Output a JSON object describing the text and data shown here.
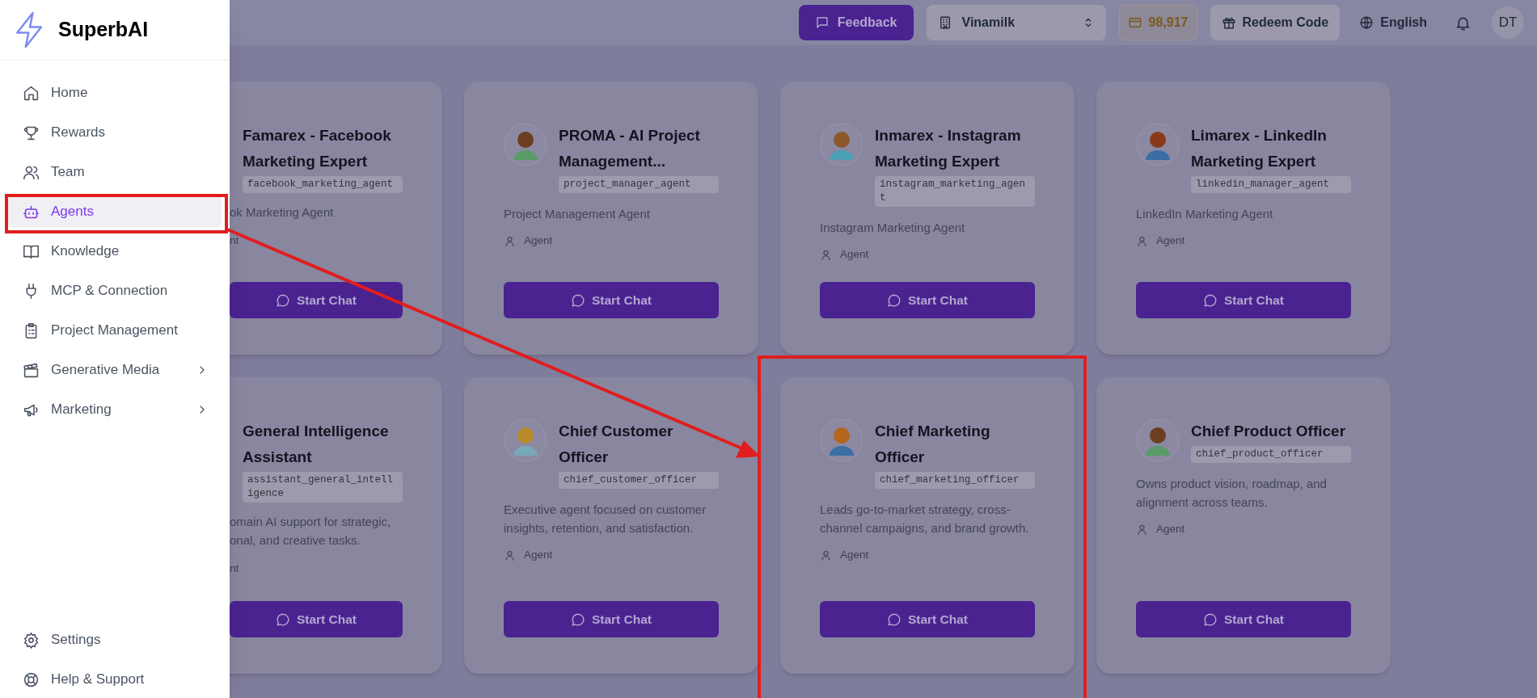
{
  "sidebar": {
    "logo": "SuperbAI",
    "items": [
      {
        "label": "Home",
        "selected": false,
        "submenu": false
      },
      {
        "label": "Rewards",
        "selected": false,
        "submenu": false
      },
      {
        "label": "Team",
        "selected": false,
        "submenu": false
      },
      {
        "label": "Agents",
        "selected": true,
        "submenu": false
      },
      {
        "label": "Knowledge",
        "selected": false,
        "submenu": false
      },
      {
        "label": "MCP & Connection",
        "selected": false,
        "submenu": false
      },
      {
        "label": "Project Management",
        "selected": false,
        "submenu": false
      },
      {
        "label": "Generative Media",
        "selected": false,
        "submenu": true
      },
      {
        "label": "Marketing",
        "selected": false,
        "submenu": true
      }
    ],
    "footer_items": [
      {
        "label": "Settings"
      },
      {
        "label": "Help & Support"
      }
    ]
  },
  "topbar": {
    "feedback": "Feedback",
    "workspace": "Vinamilk",
    "credits": "98,917",
    "redeem": "Redeem Code",
    "language": "English",
    "avatar": "DT"
  },
  "cards": [
    {
      "kind": "clipped",
      "title": "Famarex - Facebook Marketing Expert",
      "handle": "facebook_marketing_agent",
      "description_lines": [
        "ok Marketing Agent"
      ],
      "role": "nt",
      "button": "Start Chat"
    },
    {
      "kind": "full",
      "title": "PROMA - AI Project Management...",
      "handle": "project_manager_agent",
      "description": "Project Management Agent",
      "role": "Agent",
      "button": "Start Chat"
    },
    {
      "kind": "full",
      "title": "Inmarex - Instagram Marketing Expert",
      "handle": "instagram_marketing_agent",
      "description": "Instagram Marketing Agent",
      "role": "Agent",
      "button": "Start Chat"
    },
    {
      "kind": "full",
      "title": "Limarex - LinkedIn Marketing Expert",
      "handle": "linkedin_manager_agent",
      "description": "LinkedIn Marketing Agent",
      "role": "Agent",
      "button": "Start Chat"
    },
    {
      "kind": "clipped",
      "title": "General Intelligence Assistant",
      "handle": "assistant_general_intelligence",
      "description_lines": [
        "omain AI support for strategic,",
        "onal, and creative tasks."
      ],
      "role": "nt",
      "button": "Start Chat"
    },
    {
      "kind": "full",
      "title": "Chief Customer Officer",
      "handle": "chief_customer_officer",
      "description": "Executive agent focused on customer insights, retention, and satisfaction.",
      "role": "Agent",
      "button": "Start Chat"
    },
    {
      "kind": "full",
      "title": "Chief Marketing Officer",
      "handle": "chief_marketing_officer",
      "description": "Leads go-to-market strategy, cross-channel campaigns, and brand growth.",
      "role": "Agent",
      "button": "Start Chat"
    },
    {
      "kind": "full",
      "title": "Chief Product Officer",
      "handle": "chief_product_officer",
      "description": "Owns product vision, roadmap, and alignment across teams.",
      "role": "Agent",
      "button": "Start Chat"
    }
  ]
}
